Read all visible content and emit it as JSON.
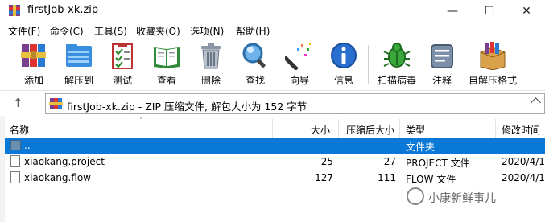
{
  "window": {
    "title": "firstJob-xk.zip",
    "minimize_glyph": "—",
    "maximize_glyph": "☐",
    "close_glyph": "✕"
  },
  "menu": [
    "文件(F)",
    "命令(C)",
    "工具(S)",
    "收藏夹(O)",
    "选项(N)",
    "帮助(H)"
  ],
  "toolbar": [
    {
      "label": "添加",
      "icon": "add-books-icon"
    },
    {
      "label": "解压到",
      "icon": "extract-folder-icon"
    },
    {
      "label": "测试",
      "icon": "test-checklist-icon"
    },
    {
      "label": "查看",
      "icon": "view-book-icon"
    },
    {
      "label": "删除",
      "icon": "trash-icon"
    },
    {
      "label": "查找",
      "icon": "magnifier-icon"
    },
    {
      "label": "向导",
      "icon": "wizard-wand-icon"
    },
    {
      "label": "信息",
      "icon": "info-icon"
    },
    {
      "label": "扫描病毒",
      "icon": "virus-scan-icon"
    },
    {
      "label": "注释",
      "icon": "comment-icon"
    },
    {
      "label": "自解压格式",
      "icon": "sfx-box-icon"
    }
  ],
  "address": {
    "up_glyph": "↑",
    "text": "firstJob-xk.zip - ZIP 压缩文件, 解包大小为 152 字节"
  },
  "columns": {
    "name": "名称",
    "size": "大小",
    "packed": "压缩后大小",
    "type": "类型",
    "modified": "修改时间"
  },
  "rows": [
    {
      "name": "..",
      "size": "",
      "packed": "",
      "type": "文件夹",
      "modified": "",
      "selected": true,
      "kind": "folder"
    },
    {
      "name": "xiaokang.project",
      "size": "25",
      "packed": "27",
      "type": "PROJECT 文件",
      "modified": "2020/4/1",
      "selected": false,
      "kind": "file"
    },
    {
      "name": "xiaokang.flow",
      "size": "127",
      "packed": "111",
      "type": "FLOW 文件",
      "modified": "2020/4/1",
      "selected": false,
      "kind": "file"
    }
  ],
  "watermark": "小康新鲜事儿",
  "colors": {
    "selection": "#0a78d7",
    "folder": "#6a8fb0"
  }
}
